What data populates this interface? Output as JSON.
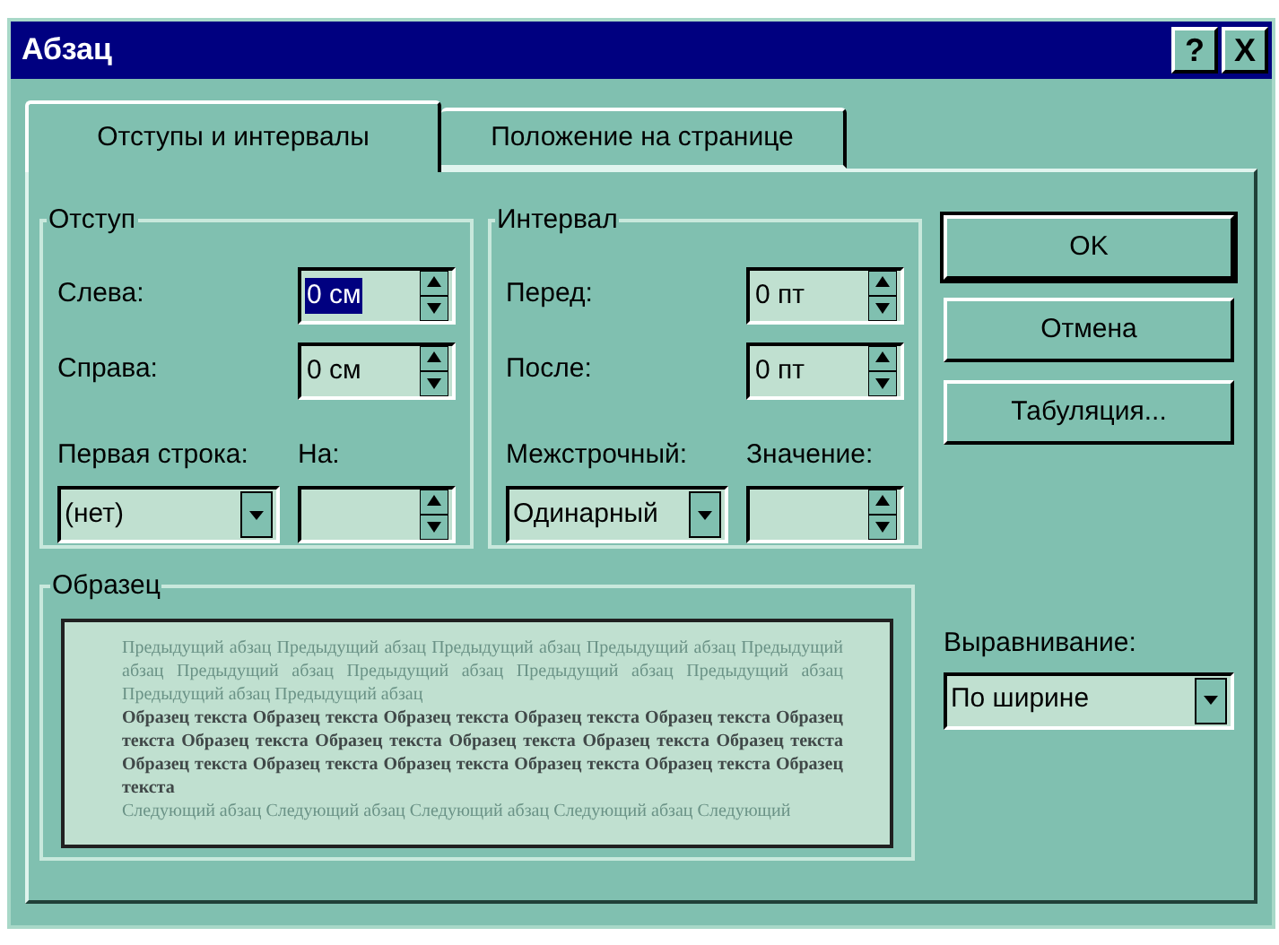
{
  "window": {
    "title": "Абзац",
    "help_button": "?",
    "close_button": "X"
  },
  "tabs": [
    {
      "label": "Отступы и интервалы",
      "selected": true
    },
    {
      "label": "Положение на странице",
      "selected": false
    }
  ],
  "indent": {
    "title": "Отступ",
    "left": {
      "label": "Слева:",
      "value": "0 см",
      "selected": true
    },
    "right": {
      "label": "Справа:",
      "value": "0 см",
      "selected": false
    },
    "first_line": {
      "label": "Первая строка:",
      "value": "(нет)"
    },
    "by": {
      "label": "На:",
      "selected": false
    }
  },
  "spacing": {
    "title": "Интервал",
    "before": {
      "label": "Перед:",
      "value": "0 пт",
      "selected": false
    },
    "after": {
      "label": "После:",
      "value": "0 пт",
      "selected": false
    },
    "line_spacing": {
      "label": "Межстрочный:",
      "value": "Одинарный"
    },
    "at": {
      "label": "Значение:",
      "selected": false
    }
  },
  "preview": {
    "title": "Образец",
    "previous": "Предыдущий абзац Предыдущий абзац Предыдущий абзац Предыдущий абзац Предыдущий абзац Предыдущий абзац Предыдущий абзац Предыдущий абзац Предыдущий абзац Предыдущий абзац Предыдущий абзац",
    "sample": "Образец текста Образец текста Образец текста Образец текста Образец текста Образец текста Образец текста Образец текста Образец текста Образец текста Образец текста Образец текста Образец текста Образец текста Образец текста Образец текста Образец текста",
    "next": "Следующий абзац Следующий абзац Следующий абзац Следующий абзац Следующий"
  },
  "buttons": [
    {
      "label": "OK",
      "default": true
    },
    {
      "label": "Отмена",
      "default": false
    },
    {
      "label": "Табуляция...",
      "default": false
    }
  ],
  "alignment": {
    "label": "Выравнивание:",
    "value": "По ширине"
  }
}
